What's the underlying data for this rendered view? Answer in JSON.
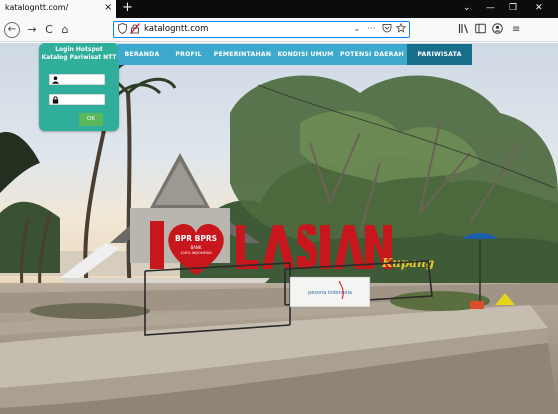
{
  "browser": {
    "tab_title": "katalogntt.com/",
    "tab_close": "×",
    "new_tab": "+",
    "url": "katalogntt.com",
    "nav": {
      "back": "←",
      "forward": "→",
      "reload": "C",
      "home": "⌂"
    },
    "url_actions": {
      "dropdown": "⌄",
      "more": "···"
    },
    "window_controls": {
      "chevron": "⌄",
      "minimize": "—",
      "restore": "❐",
      "close": "✕"
    },
    "toolbar": {
      "menu": "≡"
    }
  },
  "menu": {
    "items": [
      {
        "label": "BERANDA"
      },
      {
        "label": "PROFIL"
      },
      {
        "label": "PEMERINTAHAN"
      },
      {
        "label": "KONDISI UMUM"
      },
      {
        "label": "POTENSI DAERAH"
      },
      {
        "label": "PARIWISATA"
      }
    ],
    "active_index": 5
  },
  "login": {
    "title_line1": "Login Hotspot",
    "title_line2": "Katalog Pariwisat NTT",
    "username_icon": "user-icon",
    "password_icon": "lock-icon",
    "ok_label": "OK"
  },
  "banner": {
    "letters": "LASIANA",
    "bank_heart_line1": "BPR BPRS",
    "bank_heart_line2": "BANK",
    "bank_heart_line3": "100% INDONESIA",
    "sign_text": "pesona indonesia",
    "side_text": "Kupang"
  },
  "colors": {
    "menu_bg": "#3da9cc",
    "menu_active": "#186f8c",
    "login_bg": "#2fae9c",
    "ok_button": "#5cb85c",
    "letters_red": "#c8161d",
    "url_focus": "#0a84ff"
  }
}
